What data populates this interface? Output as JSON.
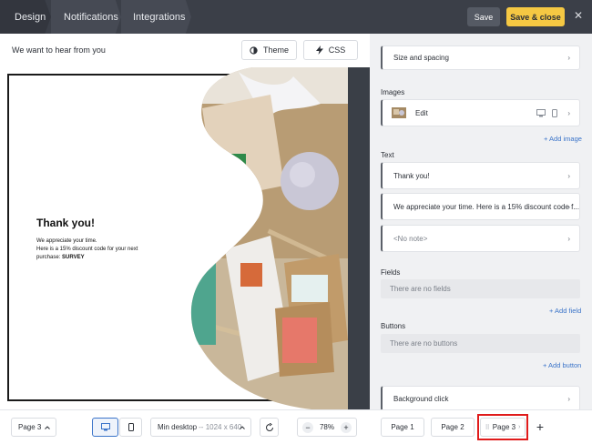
{
  "topbar": {
    "tabs": [
      "Design",
      "Notifications",
      "Integrations"
    ],
    "save_label": "Save",
    "save_close_label": "Save & close",
    "close_icon": "close-icon"
  },
  "canvas": {
    "heading": "We want to hear from you",
    "theme_label": "Theme",
    "css_label": "CSS",
    "popup": {
      "title": "Thank you!",
      "line1": "We appreciate your time.",
      "line2": "Here is a 15% discount code for your next",
      "line3_prefix": "purchase: ",
      "code": "SURVEY"
    }
  },
  "sidebar": {
    "size_spacing": "Size and spacing",
    "images_label": "Images",
    "image_edit": "Edit",
    "add_image": "+ Add image",
    "text_label": "Text",
    "text_items": [
      "Thank you!",
      "We appreciate your time. Here is a 15% discount code f...",
      "<No note>"
    ],
    "fields_label": "Fields",
    "fields_empty": "There are no fields",
    "add_field": "+ Add field",
    "buttons_label": "Buttons",
    "buttons_empty": "There are no buttons",
    "add_button": "+ Add button",
    "background_click": "Background click"
  },
  "bottombar": {
    "page_select": "Page 3",
    "device_mode": "Min desktop",
    "device_size": "-- 1024 x 640",
    "zoom": "78%",
    "pages": [
      "Page 1",
      "Page 2",
      "Page 3"
    ]
  },
  "colors": {
    "accent": "#f5c843",
    "link": "#3b74c9",
    "highlight": "#e01b1b"
  }
}
